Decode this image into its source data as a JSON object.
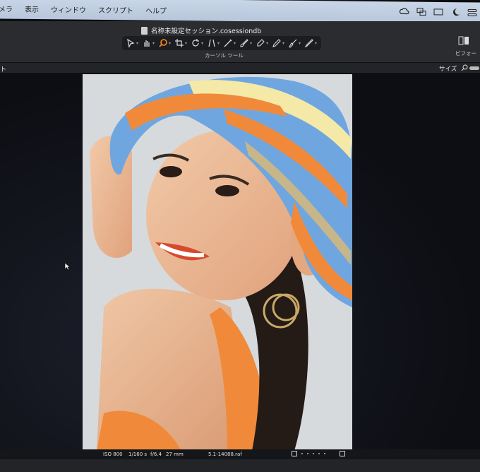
{
  "menubar": {
    "items": [
      "メラ",
      "表示",
      "ウィンドウ",
      "スクリプト",
      "ヘルプ"
    ],
    "tray_icons": [
      "creative-cloud-icon",
      "screen-mirror-icon",
      "display-icon",
      "moon-icon",
      "control-center-icon"
    ]
  },
  "window": {
    "document_title": "名称未設定セッション.cosessiondb",
    "active_tool_label": "カーソル ツール",
    "viewer_label": "ビフォー",
    "tools": [
      {
        "name": "select-cursor-tool",
        "active": false
      },
      {
        "name": "pan-tool",
        "active": false
      },
      {
        "name": "zoom-tool",
        "active": true
      },
      {
        "name": "crop-tool",
        "active": false
      },
      {
        "name": "rotate-tool",
        "active": false
      },
      {
        "name": "keystone-tool",
        "active": false
      },
      {
        "name": "picker-tool",
        "active": false
      },
      {
        "name": "brush-tool",
        "active": false
      },
      {
        "name": "eraser-tool",
        "active": false
      },
      {
        "name": "mask-tool",
        "active": false
      },
      {
        "name": "clone-tool",
        "active": false
      },
      {
        "name": "annotation-tool",
        "active": false
      }
    ],
    "accent_color": "#ff8a1a"
  },
  "subbar": {
    "left_fragment": "ト",
    "size_label": "サイズ"
  },
  "photo_info": {
    "iso": "ISO 800",
    "shutter": "1/160 s",
    "aperture": "f/6.4",
    "focal": "27 mm",
    "filename": "5.1-14088.raf"
  }
}
